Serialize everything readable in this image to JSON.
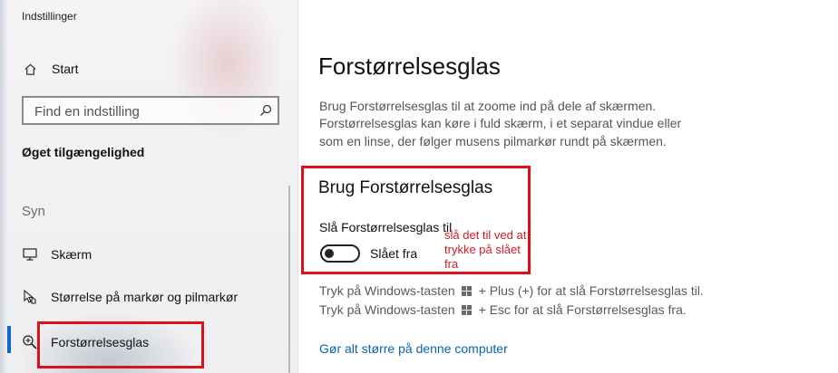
{
  "window": {
    "title": "Indstillinger"
  },
  "sidebar": {
    "home_label": "Start",
    "search_placeholder": "Find en indstilling",
    "section_heading": "Øget tilgængelighed",
    "group_label": "Syn",
    "items": [
      {
        "label": "Skærm",
        "icon": "display-icon"
      },
      {
        "label": "Størrelse på markør og pilmarkør",
        "icon": "cursor-icon"
      },
      {
        "label": "Forstørrelsesglas",
        "icon": "magnifier-icon",
        "selected": true
      }
    ]
  },
  "main": {
    "title": "Forstørrelsesglas",
    "description": [
      "Brug Forstørrelsesglas til at zoome ind på dele af skærmen.",
      "Forstørrelsesglas kan køre i fuld skærm, i et separat vindue eller",
      "som en linse, der følger musens pilmarkør rundt på skærmen."
    ],
    "toggle_section_heading": "Brug Forstørrelsesglas",
    "toggle_label": "Slå Forstørrelsesglas til",
    "toggle_state_text": "Slået fra",
    "toggle_on": false,
    "annotation": "slå det til ved at trykke på slået fra",
    "hint_on": {
      "prefix": "Tryk på Windows-tasten",
      "suffix": "+ Plus (+) for at slå Forstørrelsesglas til."
    },
    "hint_off": {
      "prefix": "Tryk på Windows-tasten",
      "suffix": "+ Esc for at slå Forstørrelsesglas fra."
    },
    "link_text": "Gør alt større på denne computer"
  },
  "colors": {
    "accent": "#1167c9",
    "highlight_red": "#e0101a",
    "link": "#0a62b3"
  }
}
